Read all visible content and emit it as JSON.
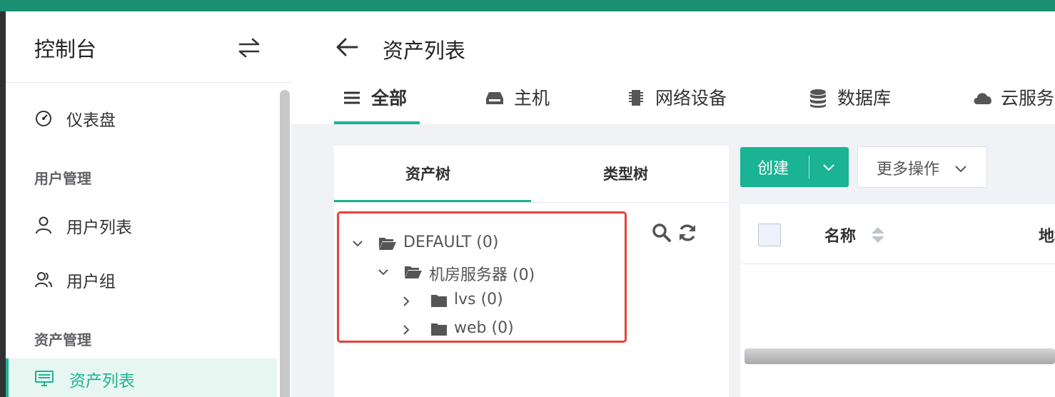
{
  "sidebar": {
    "title": "控制台",
    "items": [
      {
        "label": "仪表盘"
      },
      {
        "label": "用户列表"
      },
      {
        "label": "用户组"
      },
      {
        "label": "资产列表"
      }
    ],
    "groups": [
      "用户管理",
      "资产管理"
    ]
  },
  "main": {
    "title": "资产列表",
    "tabs": [
      {
        "label": "全部",
        "icon": "list-icon"
      },
      {
        "label": "主机",
        "icon": "host-icon"
      },
      {
        "label": "网络设备",
        "icon": "network-device-icon"
      },
      {
        "label": "数据库",
        "icon": "database-icon"
      },
      {
        "label": "云服务",
        "icon": "cloud-icon"
      }
    ],
    "tree_tabs": [
      "资产树",
      "类型树"
    ],
    "tree": [
      {
        "label": "DEFAULT (0)"
      },
      {
        "label": "机房服务器 (0)"
      },
      {
        "label": "lvs (0)"
      },
      {
        "label": "web (0)"
      }
    ],
    "buttons": {
      "create": "创建",
      "more": "更多操作"
    },
    "table": {
      "columns": [
        "名称",
        "地址"
      ]
    }
  },
  "colors": {
    "accent": "#1ab394",
    "topbar": "#1a8f72",
    "highlight": "#e8403a"
  }
}
